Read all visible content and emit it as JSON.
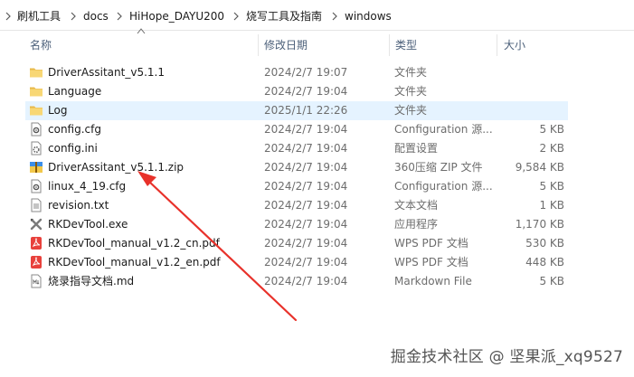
{
  "breadcrumb": {
    "items": [
      "刷机工具",
      "docs",
      "HiHope_DAYU200",
      "烧写工具及指南",
      "windows"
    ]
  },
  "columns": {
    "name": "名称",
    "date": "修改日期",
    "type": "类型",
    "size": "大小"
  },
  "files": [
    {
      "name": "DriverAssitant_v5.1.1",
      "date": "2024/2/7 19:07",
      "type": "文件夹",
      "size": "",
      "icon": "folder-icon"
    },
    {
      "name": "Language",
      "date": "2024/2/7 19:04",
      "type": "文件夹",
      "size": "",
      "icon": "folder-icon"
    },
    {
      "name": "Log",
      "date": "2025/1/1 22:26",
      "type": "文件夹",
      "size": "",
      "icon": "folder-icon"
    },
    {
      "name": "config.cfg",
      "date": "2024/2/7 19:04",
      "type": "Configuration 源...",
      "size": "5 KB",
      "icon": "config-file-icon"
    },
    {
      "name": "config.ini",
      "date": "2024/2/7 19:04",
      "type": "配置设置",
      "size": "2 KB",
      "icon": "settings-file-icon"
    },
    {
      "name": "DriverAssitant_v5.1.1.zip",
      "date": "2024/2/7 19:04",
      "type": "360压缩 ZIP 文件",
      "size": "9,584 KB",
      "icon": "zip-archive-icon"
    },
    {
      "name": "linux_4_19.cfg",
      "date": "2024/2/7 19:04",
      "type": "Configuration 源...",
      "size": "5 KB",
      "icon": "config-file-icon"
    },
    {
      "name": "revision.txt",
      "date": "2024/2/7 19:04",
      "type": "文本文档",
      "size": "1 KB",
      "icon": "text-file-icon"
    },
    {
      "name": "RKDevTool.exe",
      "date": "2024/2/7 19:04",
      "type": "应用程序",
      "size": "1,170 KB",
      "icon": "rkdevtool-app-icon"
    },
    {
      "name": "RKDevTool_manual_v1.2_cn.pdf",
      "date": "2024/2/7 19:04",
      "type": "WPS PDF 文档",
      "size": "530 KB",
      "icon": "pdf-file-icon"
    },
    {
      "name": "RKDevTool_manual_v1.2_en.pdf",
      "date": "2024/2/7 19:04",
      "type": "WPS PDF 文档",
      "size": "448 KB",
      "icon": "pdf-file-icon"
    },
    {
      "name": "烧录指导文档.md",
      "date": "2024/2/7 19:04",
      "type": "Markdown File",
      "size": "5 KB",
      "icon": "markdown-file-icon"
    }
  ],
  "selected_index": 2,
  "watermark": "掘金技术社区 @ 坚果派_xq9527",
  "colors": {
    "selection": "#e5f3ff",
    "folder": "#f8d775",
    "annotation_arrow": "#e8312a"
  }
}
